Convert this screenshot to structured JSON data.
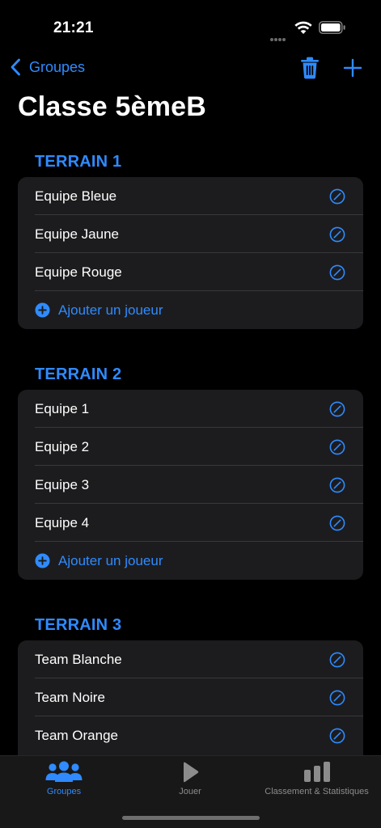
{
  "status_bar": {
    "time": "21:21"
  },
  "nav": {
    "back_label": "Groupes",
    "trash_icon": "trash-icon",
    "add_icon": "plus-icon"
  },
  "page": {
    "title": "Classe 5èmeB"
  },
  "colors": {
    "accent": "#2f8bff",
    "card": "#1c1c1e",
    "background": "#000000"
  },
  "sections": [
    {
      "header": "TERRAIN 1",
      "teams": [
        "Equipe Bleue",
        "Equipe Jaune",
        "Equipe Rouge"
      ],
      "add_label": "Ajouter un joueur"
    },
    {
      "header": "TERRAIN 2",
      "teams": [
        "Equipe 1",
        "Equipe 2",
        "Equipe 3",
        "Equipe 4"
      ],
      "add_label": "Ajouter un joueur"
    },
    {
      "header": "TERRAIN 3",
      "teams": [
        "Team Blanche",
        "Team Noire",
        "Team Orange"
      ]
    }
  ],
  "tab_bar": {
    "tabs": [
      {
        "label": "Groupes",
        "icon": "people-icon",
        "active": true
      },
      {
        "label": "Jouer",
        "icon": "play-icon",
        "active": false
      },
      {
        "label": "Classement & Statistiques",
        "icon": "bar-chart-icon",
        "active": false
      }
    ]
  }
}
